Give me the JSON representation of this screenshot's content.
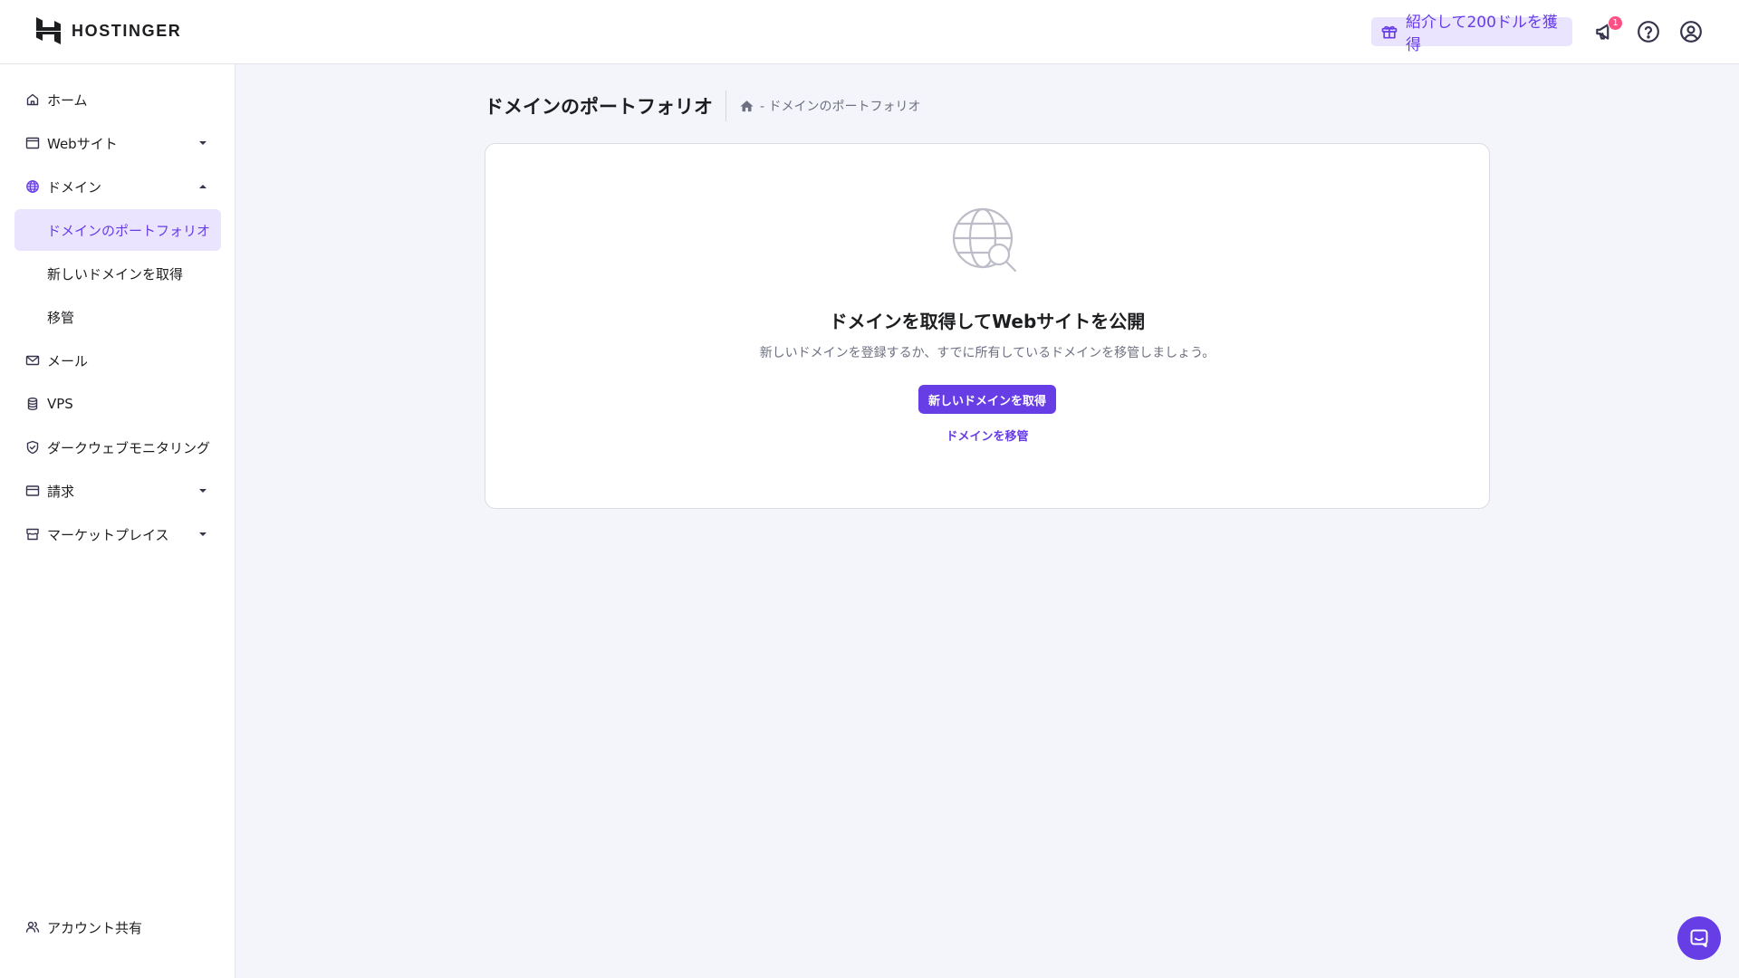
{
  "header": {
    "logo_text": "HOSTINGER",
    "referral_label": "紹介して200ドルを獲得",
    "notification_count": "1"
  },
  "sidebar": {
    "items": [
      {
        "label": "ホーム",
        "icon": "home-icon"
      },
      {
        "label": "Webサイト",
        "icon": "browser-window-icon",
        "expandable": true,
        "expanded": false
      },
      {
        "label": "ドメイン",
        "icon": "globe-icon",
        "expandable": true,
        "expanded": true
      },
      {
        "label": "ドメインのポートフォリオ",
        "sub": true,
        "active": true
      },
      {
        "label": "新しいドメインを取得",
        "sub": true
      },
      {
        "label": "移管",
        "sub": true
      },
      {
        "label": "メール",
        "icon": "mail-icon"
      },
      {
        "label": "VPS",
        "icon": "server-icon"
      },
      {
        "label": "ダークウェブモニタリング",
        "icon": "shield-icon"
      },
      {
        "label": "請求",
        "icon": "credit-card-icon",
        "expandable": true,
        "expanded": false
      },
      {
        "label": "マーケットプレイス",
        "icon": "marketplace-icon",
        "expandable": true,
        "expanded": false
      }
    ],
    "footer_item": {
      "label": "アカウント共有",
      "icon": "users-icon"
    }
  },
  "main": {
    "title": "ドメインのポートフォリオ",
    "breadcrumb": "- ドメインのポートフォリオ",
    "empty_state": {
      "title": "ドメインを取得してWebサイトを公開",
      "description": "新しいドメインを登録するか、すでに所有しているドメインを移管しましょう。",
      "primary_button": "新しいドメインを取得",
      "secondary_link": "ドメインを移管"
    }
  },
  "colors": {
    "accent": "#673de6",
    "accent_light": "#ebe4ff",
    "page_bg": "#f4f4fb",
    "badge": "#fc5185"
  }
}
